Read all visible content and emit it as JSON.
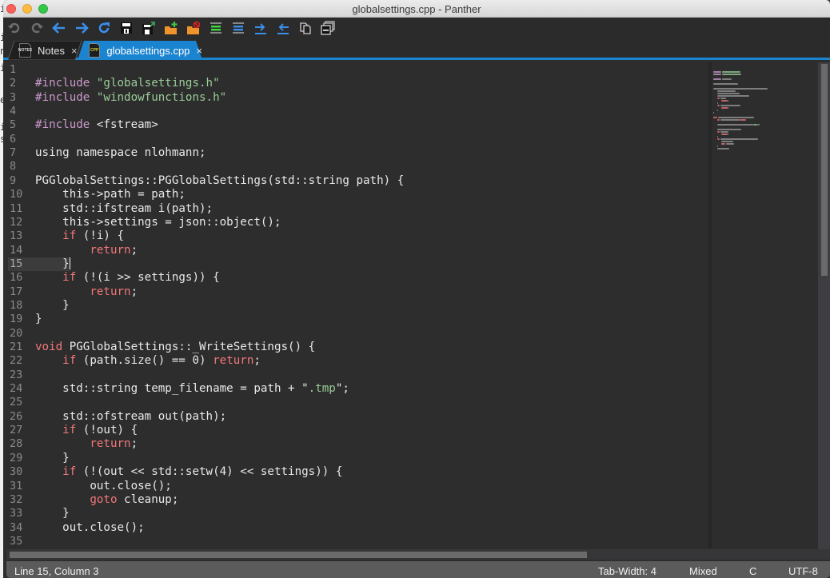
{
  "window": {
    "title": "globalsettings.cpp - Panther"
  },
  "toolbar": {
    "buttons": [
      {
        "name": "undo",
        "icon": "undo-icon"
      },
      {
        "name": "redo",
        "icon": "redo-icon"
      },
      {
        "name": "back",
        "icon": "arrow-left-icon"
      },
      {
        "name": "forward",
        "icon": "arrow-right-icon"
      },
      {
        "name": "refresh",
        "icon": "refresh-icon"
      },
      {
        "name": "save",
        "icon": "save-icon"
      },
      {
        "name": "save-as",
        "icon": "save-as-icon"
      },
      {
        "name": "new-folder",
        "icon": "folder-add-icon"
      },
      {
        "name": "close-folder",
        "icon": "folder-remove-icon"
      },
      {
        "name": "show-whitespace",
        "icon": "lines-green-icon"
      },
      {
        "name": "align",
        "icon": "lines-blue-icon"
      },
      {
        "name": "indent",
        "icon": "indent-icon"
      },
      {
        "name": "unindent",
        "icon": "unindent-icon"
      },
      {
        "name": "copy",
        "icon": "copy-icon"
      },
      {
        "name": "minimize-windows",
        "icon": "windows-icon"
      }
    ]
  },
  "tabs": [
    {
      "label": "Notes",
      "file_badge": "NOTES",
      "active": false,
      "close": "×"
    },
    {
      "label": "globalsettings.cpp",
      "file_badge": "CPP",
      "active": true,
      "close": "×"
    }
  ],
  "editor": {
    "current_line": 15,
    "lines": [
      {
        "n": "1",
        "tokens": []
      },
      {
        "n": "2",
        "tokens": [
          {
            "t": "pp",
            "v": "#include"
          },
          {
            "t": "",
            "v": " "
          },
          {
            "t": "str",
            "v": "\"globalsettings.h\""
          }
        ]
      },
      {
        "n": "3",
        "tokens": [
          {
            "t": "pp",
            "v": "#include"
          },
          {
            "t": "",
            "v": " "
          },
          {
            "t": "str",
            "v": "\"windowfunctions.h\""
          }
        ]
      },
      {
        "n": "4",
        "tokens": []
      },
      {
        "n": "5",
        "tokens": [
          {
            "t": "pp",
            "v": "#include"
          },
          {
            "t": "",
            "v": " <fstream>"
          }
        ]
      },
      {
        "n": "6",
        "tokens": []
      },
      {
        "n": "7",
        "tokens": [
          {
            "t": "",
            "v": "using namespace nlohmann;"
          }
        ]
      },
      {
        "n": "8",
        "tokens": []
      },
      {
        "n": "9",
        "tokens": [
          {
            "t": "",
            "v": "PGGlobalSettings::PGGlobalSettings(std::string path) {"
          }
        ]
      },
      {
        "n": "10",
        "tokens": [
          {
            "t": "",
            "v": "    this->path = path;"
          }
        ]
      },
      {
        "n": "11",
        "tokens": [
          {
            "t": "",
            "v": "    std::ifstream i(path);"
          }
        ]
      },
      {
        "n": "12",
        "tokens": [
          {
            "t": "",
            "v": "    this->settings = json::object();"
          }
        ]
      },
      {
        "n": "13",
        "tokens": [
          {
            "t": "",
            "v": "    "
          },
          {
            "t": "kw",
            "v": "if"
          },
          {
            "t": "",
            "v": " (!i) {"
          }
        ]
      },
      {
        "n": "14",
        "tokens": [
          {
            "t": "",
            "v": "        "
          },
          {
            "t": "kw",
            "v": "return"
          },
          {
            "t": "",
            "v": ";"
          }
        ]
      },
      {
        "n": "15",
        "tokens": [
          {
            "t": "",
            "v": "    }"
          },
          {
            "t": "caret",
            "v": ""
          }
        ]
      },
      {
        "n": "16",
        "tokens": [
          {
            "t": "",
            "v": "    "
          },
          {
            "t": "kw",
            "v": "if"
          },
          {
            "t": "",
            "v": " (!(i >> settings)) {"
          }
        ]
      },
      {
        "n": "17",
        "tokens": [
          {
            "t": "",
            "v": "        "
          },
          {
            "t": "kw",
            "v": "return"
          },
          {
            "t": "",
            "v": ";"
          }
        ]
      },
      {
        "n": "18",
        "tokens": [
          {
            "t": "",
            "v": "    }"
          }
        ]
      },
      {
        "n": "19",
        "tokens": [
          {
            "t": "",
            "v": "}"
          }
        ]
      },
      {
        "n": "20",
        "tokens": []
      },
      {
        "n": "21",
        "tokens": [
          {
            "t": "kw",
            "v": "void"
          },
          {
            "t": "",
            "v": " PGGlobalSettings::_WriteSettings() {"
          }
        ]
      },
      {
        "n": "22",
        "tokens": [
          {
            "t": "",
            "v": "    "
          },
          {
            "t": "kw",
            "v": "if"
          },
          {
            "t": "",
            "v": " (path.size() == 0) "
          },
          {
            "t": "kw",
            "v": "return"
          },
          {
            "t": "",
            "v": ";"
          }
        ]
      },
      {
        "n": "23",
        "tokens": []
      },
      {
        "n": "24",
        "tokens": [
          {
            "t": "",
            "v": "    std::string temp_filename = path + \""
          },
          {
            "t": "str",
            "v": ".tmp"
          },
          {
            "t": "",
            "v": "\";"
          }
        ]
      },
      {
        "n": "25",
        "tokens": []
      },
      {
        "n": "26",
        "tokens": [
          {
            "t": "",
            "v": "    std::ofstream out(path);"
          }
        ]
      },
      {
        "n": "27",
        "tokens": [
          {
            "t": "",
            "v": "    "
          },
          {
            "t": "kw",
            "v": "if"
          },
          {
            "t": "",
            "v": " (!out) {"
          }
        ]
      },
      {
        "n": "28",
        "tokens": [
          {
            "t": "",
            "v": "        "
          },
          {
            "t": "kw",
            "v": "return"
          },
          {
            "t": "",
            "v": ";"
          }
        ]
      },
      {
        "n": "29",
        "tokens": [
          {
            "t": "",
            "v": "    }"
          }
        ]
      },
      {
        "n": "30",
        "tokens": [
          {
            "t": "",
            "v": "    "
          },
          {
            "t": "kw",
            "v": "if"
          },
          {
            "t": "",
            "v": " (!(out << std::setw(4) << settings)) {"
          }
        ]
      },
      {
        "n": "31",
        "tokens": [
          {
            "t": "",
            "v": "        out.close();"
          }
        ]
      },
      {
        "n": "32",
        "tokens": [
          {
            "t": "",
            "v": "        "
          },
          {
            "t": "kw",
            "v": "goto"
          },
          {
            "t": "",
            "v": " cleanup;"
          }
        ]
      },
      {
        "n": "33",
        "tokens": [
          {
            "t": "",
            "v": "    }"
          }
        ]
      },
      {
        "n": "34",
        "tokens": [
          {
            "t": "",
            "v": "    out.close();"
          }
        ]
      },
      {
        "n": "35",
        "tokens": []
      }
    ]
  },
  "statusbar": {
    "position": "Line 15, Column 3",
    "tab_width": "Tab-Width: 4",
    "line_endings": "Mixed",
    "language": "C",
    "encoding": "UTF-8"
  },
  "colors": {
    "accent": "#1b84d0",
    "keyword": "#f2777a",
    "preprocessor": "#cc99cc",
    "string": "#99cc99",
    "editor_bg": "#2d2d2d"
  }
}
